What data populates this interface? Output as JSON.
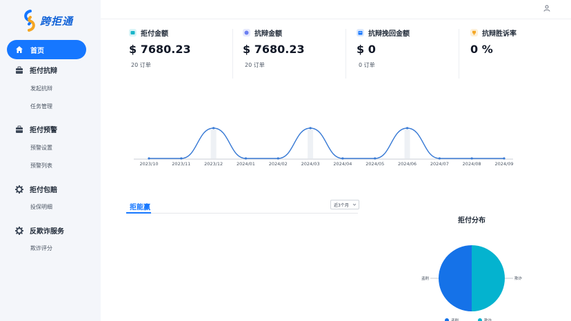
{
  "app": {
    "name": "跨拒通"
  },
  "colors": {
    "accent": "#1677ff",
    "series_a": "#1572e8",
    "series_b": "#04b3cf"
  },
  "sidebar": {
    "home": "首页",
    "groups": [
      {
        "label": "拒付抗辩",
        "icon": "briefcase-icon",
        "items": [
          "发起抗辩",
          "任务管理"
        ]
      },
      {
        "label": "拒付预警",
        "icon": "briefcase-icon",
        "items": [
          "预警设置",
          "预警列表"
        ]
      },
      {
        "label": "拒付包赔",
        "icon": "gear-icon",
        "items": [
          "投保明细"
        ]
      },
      {
        "label": "反欺诈服务",
        "icon": "gear-icon",
        "items": [
          "欺诈评分"
        ]
      }
    ]
  },
  "stats": [
    {
      "title": "拒付金额",
      "value": "$ 7680.23",
      "sub": "20 订单",
      "icon": "wallet-icon",
      "color": "#19b5c9"
    },
    {
      "title": "抗辩金额",
      "value": "$ 7680.23",
      "sub": "20 订单",
      "icon": "shield-icon",
      "color": "#6b7ff2"
    },
    {
      "title": "抗辩挽回金额",
      "value": "$ 0",
      "sub": "0 订单",
      "icon": "calendar-icon",
      "color": "#1677ff"
    },
    {
      "title": "抗辩胜诉率",
      "value": "0 %",
      "sub": "",
      "icon": "trophy-icon",
      "color": "#f5a623"
    }
  ],
  "tabs": {
    "active": "拒能赢"
  },
  "filter": {
    "selected": "近3个月"
  },
  "pie": {
    "title": "拒付分布"
  },
  "chart_data": [
    {
      "type": "line",
      "categories": [
        "2023/10",
        "2023/11",
        "2023/12",
        "2024/01",
        "2024/02",
        "2024/03",
        "2024/04",
        "2024/05",
        "2024/06",
        "2024/07",
        "2024/08",
        "2024/09"
      ],
      "series": [
        {
          "values": [
            0,
            0,
            1,
            0,
            0,
            1,
            0,
            0,
            1,
            0,
            0,
            0
          ]
        }
      ],
      "grid": false
    },
    {
      "type": "pie",
      "title": "拒付分布",
      "slices": [
        {
          "label": "盗刷",
          "value": 50
        },
        {
          "label": "欺诈",
          "value": 50
        }
      ]
    }
  ]
}
